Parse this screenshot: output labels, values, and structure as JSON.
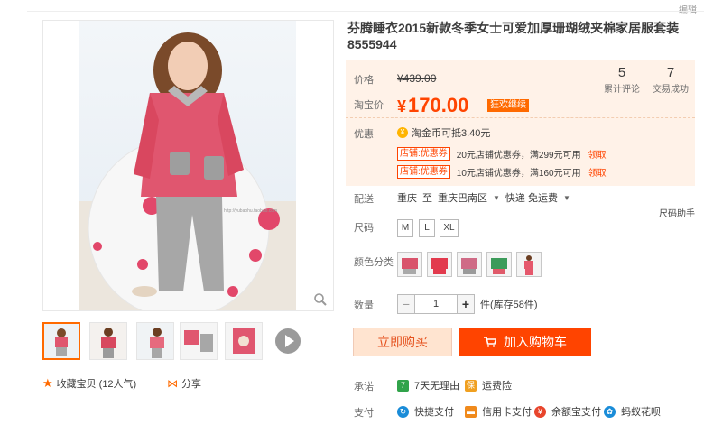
{
  "top": {
    "edit_label": "编辑",
    "size_helper": "尺码助手"
  },
  "gallery": {
    "watermark": "http://yubaohu.taobao.com",
    "favorite_label": "收藏宝贝",
    "favorite_count": "(12人气)",
    "share_label": "分享",
    "thumbs": [
      "main-front",
      "front-red",
      "side",
      "set-flat",
      "print-top"
    ]
  },
  "product": {
    "title": "芬腾睡衣2015新款冬季女士可爱加厚珊瑚绒夹棉家居服套装8555944"
  },
  "price": {
    "original_label": "价格",
    "original_value": "¥439.00",
    "taobao_label": "淘宝价",
    "currency": "¥",
    "taobao_value": "170.00",
    "promo_tag": "狂欢继续",
    "reviews_count": "5",
    "reviews_label": "累计评论",
    "sales_count": "7",
    "sales_label": "交易成功",
    "discount_label": "优惠",
    "coin_text": "淘金币可抵3.40元",
    "coupons": [
      {
        "tag": "店铺:优惠券",
        "text": "20元店铺优惠券，满299元可用",
        "action": "领取"
      },
      {
        "tag": "店铺:优惠券",
        "text": "10元店铺优惠券，满160元可用",
        "action": "领取"
      }
    ]
  },
  "shipping": {
    "label": "配送",
    "from": "重庆",
    "to_word": "至",
    "dest": "重庆巴南区",
    "method": "快递 免运费"
  },
  "size": {
    "label": "尺码",
    "options": [
      "M",
      "L",
      "XL"
    ]
  },
  "color": {
    "label": "颜色分类",
    "swatch_colors": [
      "#d9536b",
      "#e23a4d",
      "#cf6b86",
      "#3c9b5a",
      "#e5586c"
    ]
  },
  "quantity": {
    "label": "数量",
    "minus": "−",
    "value": "1",
    "plus": "+",
    "stock": "件(库存58件)"
  },
  "actions": {
    "buy_now": "立即购买",
    "add_to_cart": "加入购物车"
  },
  "promise": {
    "label": "承诺",
    "items": [
      {
        "icon": "7",
        "text": "7天无理由"
      },
      {
        "icon": "保",
        "text": "运费险"
      }
    ]
  },
  "payment": {
    "label": "支付",
    "items": [
      {
        "text": "快捷支付"
      },
      {
        "text": "信用卡支付"
      },
      {
        "text": "余额宝支付"
      },
      {
        "text": "蚂蚁花呗"
      }
    ]
  },
  "colors": {
    "accent": "#ff4400",
    "accent_orange": "#ff6a00",
    "price_bg": "#fff2e8",
    "buy_bg": "#ffe4d0"
  }
}
